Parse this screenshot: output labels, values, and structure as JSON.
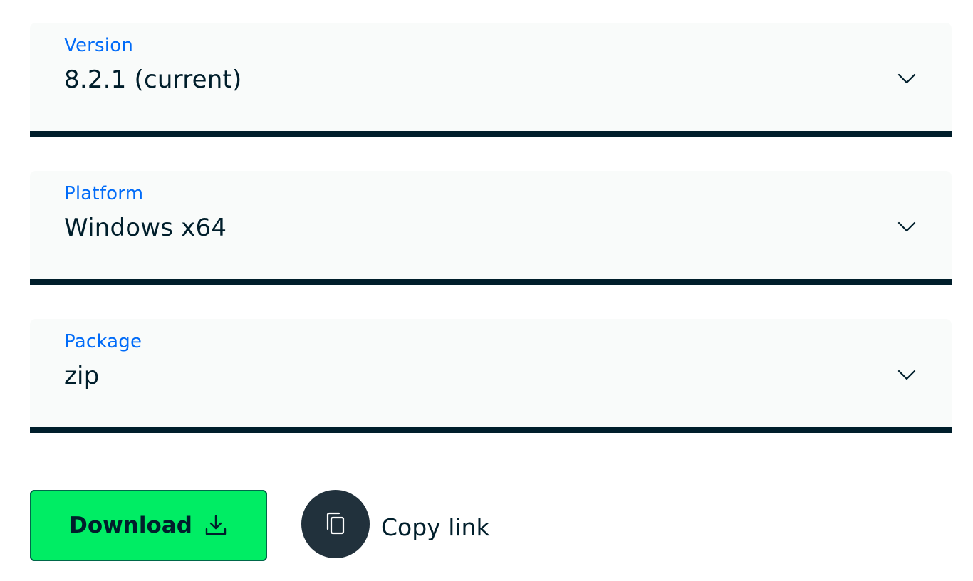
{
  "version_select": {
    "label": "Version",
    "value": "8.2.1 (current)",
    "icon": "chevron-down-icon"
  },
  "platform_select": {
    "label": "Platform",
    "value": "Windows x64",
    "icon": "chevron-down-icon"
  },
  "package_select": {
    "label": "Package",
    "value": "zip",
    "icon": "chevron-down-icon"
  },
  "actions": {
    "download_label": "Download",
    "download_icon": "download-icon",
    "copy_label": "Copy link",
    "copy_icon": "copy-icon"
  },
  "colors": {
    "label_blue": "#016bf8",
    "text_dark": "#001e2b",
    "field_bg": "#f9fbfa",
    "download_green": "#00ed64",
    "download_border": "#00684a",
    "copy_circle": "#21313c"
  }
}
